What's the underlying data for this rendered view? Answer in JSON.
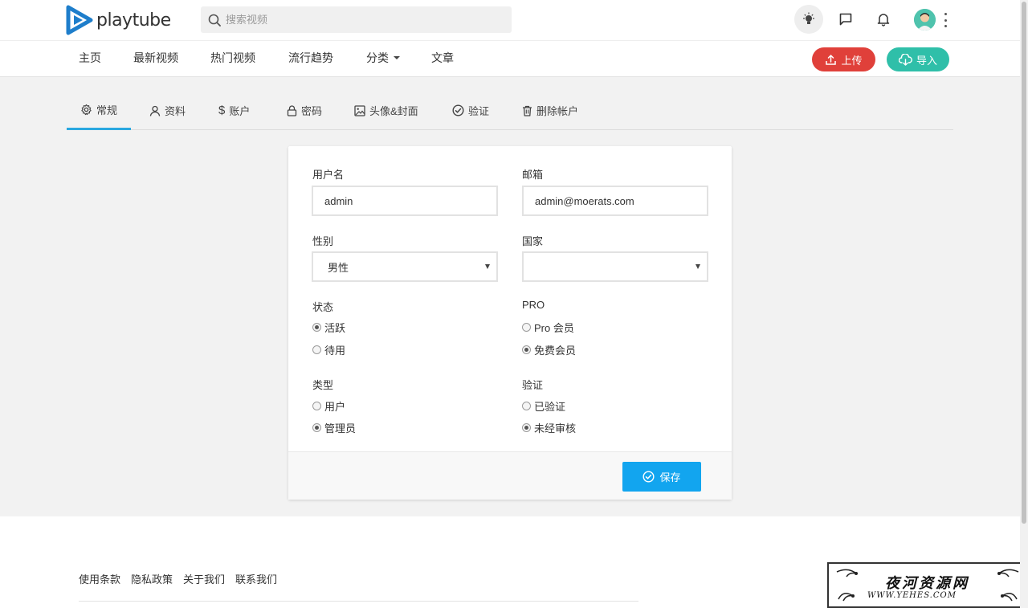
{
  "header": {
    "logo_text": "playtube",
    "search_placeholder": "搜索视频",
    "icons": [
      "bulb-icon",
      "chat-icon",
      "bell-icon",
      "avatar",
      "kebab-icon"
    ]
  },
  "nav": {
    "items": [
      {
        "label": "主页"
      },
      {
        "label": "最新视频"
      },
      {
        "label": "热门视频"
      },
      {
        "label": "流行趋势"
      },
      {
        "label": "分类"
      },
      {
        "label": "文章"
      }
    ],
    "upload_label": "上传",
    "import_label": "导入",
    "upload_color": "#e0403a",
    "import_color": "#2fbfa9"
  },
  "tabs": [
    {
      "label": "常规",
      "icon": "gear-icon",
      "active": true
    },
    {
      "label": "资料",
      "icon": "user-icon"
    },
    {
      "label": "账户",
      "icon": "dollar-icon"
    },
    {
      "label": "密码",
      "icon": "lock-icon"
    },
    {
      "label": "头像&封面",
      "icon": "image-icon"
    },
    {
      "label": "验证",
      "icon": "check-badge-icon"
    },
    {
      "label": "删除帐户",
      "icon": "trash-icon"
    }
  ],
  "form": {
    "username_label": "用户名",
    "username_value": "admin",
    "email_label": "邮箱",
    "email_value": "admin@moerats.com",
    "gender_label": "性别",
    "gender_value": "男性",
    "country_label": "国家",
    "country_value": "",
    "status_label": "状态",
    "status_options": [
      {
        "label": "活跃",
        "checked": true
      },
      {
        "label": "待用",
        "checked": false
      }
    ],
    "pro_label": "PRO",
    "pro_options": [
      {
        "label": "Pro 会员",
        "checked": false
      },
      {
        "label": "免费会员",
        "checked": true
      }
    ],
    "type_label": "类型",
    "type_options": [
      {
        "label": "用户",
        "checked": false
      },
      {
        "label": "管理员",
        "checked": true
      }
    ],
    "verify_label": "验证",
    "verify_options": [
      {
        "label": "已验证",
        "checked": false
      },
      {
        "label": "未经审核",
        "checked": true
      }
    ],
    "save_label": "保存",
    "save_color": "#12a5ef"
  },
  "footer": {
    "links": [
      {
        "label": "使用条款"
      },
      {
        "label": "隐私政策"
      },
      {
        "label": "关于我们"
      },
      {
        "label": "联系我们"
      }
    ]
  },
  "watermark": {
    "title": "夜河资源网",
    "url": "WWW.YEHES.COM"
  },
  "accent_color": "#2aa8e0"
}
